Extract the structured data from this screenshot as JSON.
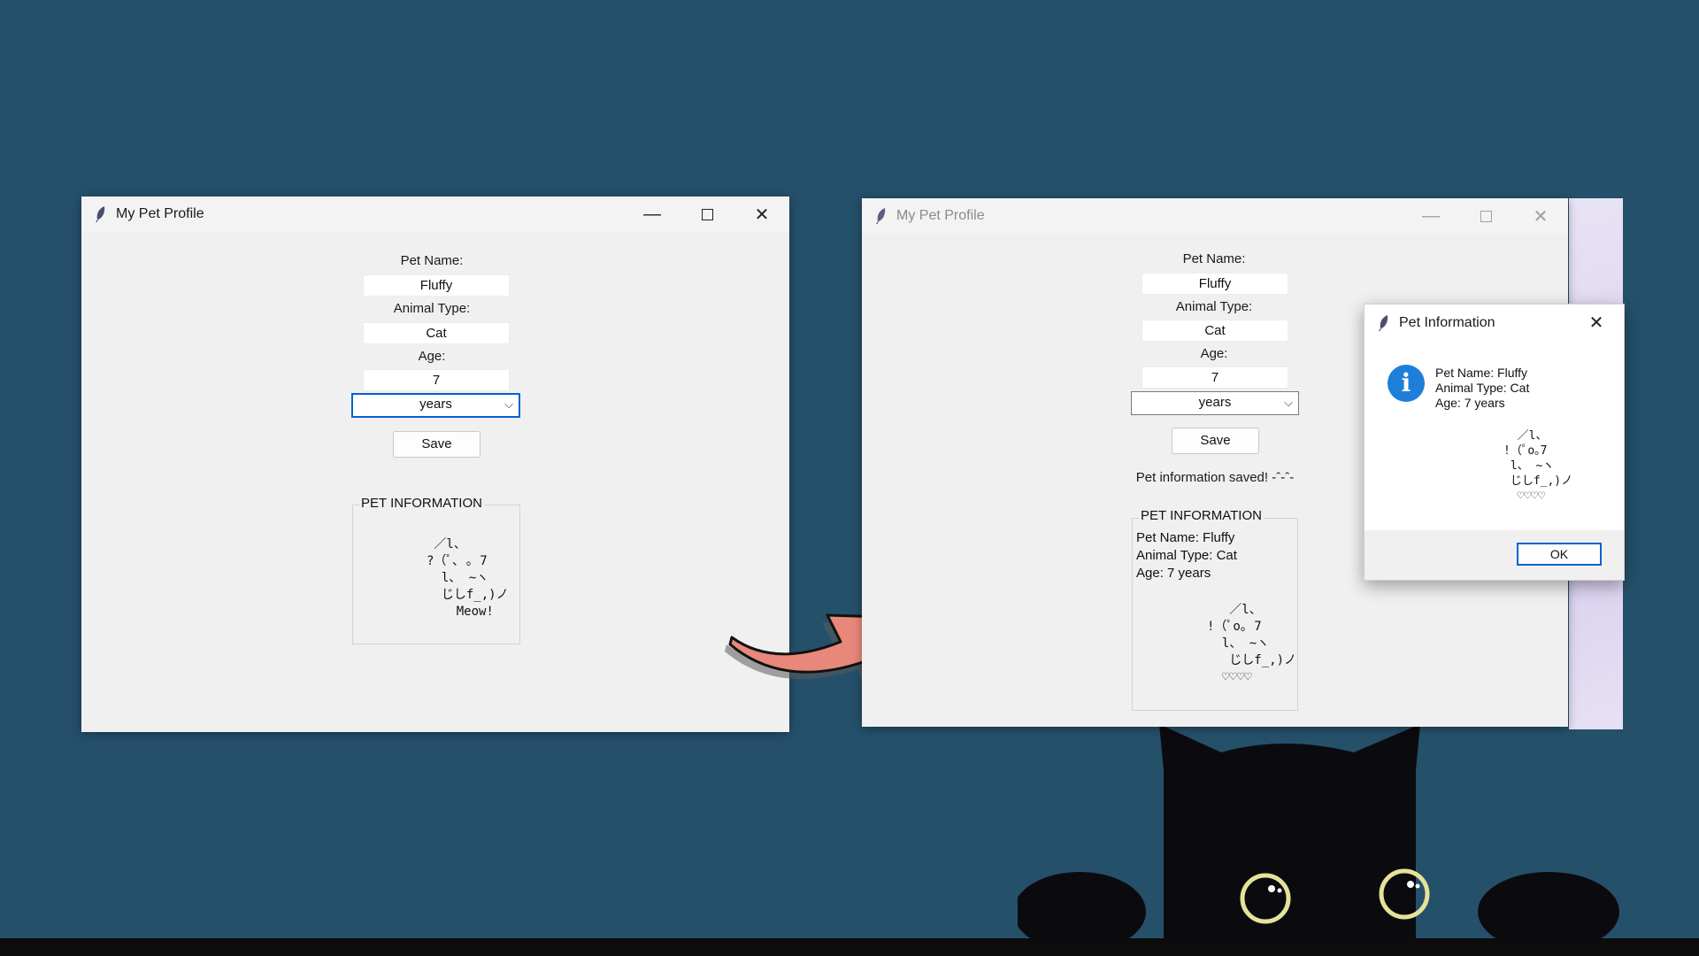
{
  "window_left": {
    "title": "My Pet Profile",
    "labels": {
      "pet_name": "Pet Name:",
      "animal_type": "Animal Type:",
      "age": "Age:"
    },
    "values": {
      "pet_name": "Fluffy",
      "animal_type": "Cat",
      "age": "7"
    },
    "age_unit": "years",
    "save_label": "Save",
    "frame_title": "PET INFORMATION",
    "ascii_art": " ／l、\n?（ﾟ､ ｡ 7\n  l、 ~ヽ\n  じしf_,)ノ\n    Meow!"
  },
  "window_right": {
    "title": "My Pet Profile",
    "labels": {
      "pet_name": "Pet Name:",
      "animal_type": "Animal Type:",
      "age": "Age:"
    },
    "values": {
      "pet_name": "Fluffy",
      "animal_type": "Cat",
      "age": "7"
    },
    "age_unit": "years",
    "save_label": "Save",
    "status": "Pet information saved! -ˆ-ˆ-",
    "frame_title": "PET INFORMATION",
    "info_lines": [
      "Pet Name: Fluffy",
      "Animal Type: Cat",
      "Age: 7 years"
    ],
    "ascii_art": "   ／l、\n!（ﾟo｡ 7\n  l、 ~ヽ\n   じしf_,)ノ\n  ♡♡♡♡"
  },
  "dialog": {
    "title": "Pet Information",
    "lines": [
      "Pet Name: Fluffy",
      "Animal Type: Cat",
      "Age: 7 years"
    ],
    "ascii_art": "  ／l、\n!（ﾟo｡7\n l、 ~ヽ\n じしf_,)ノ\n  ♡♡♡♡",
    "ok_label": "OK"
  },
  "icons": {
    "app": "feather-icon",
    "minimize": "minimize-icon",
    "maximize": "maximize-icon",
    "close": "close-icon",
    "dropdown": "chevron-down-icon",
    "info": "info-icon"
  },
  "colors": {
    "desktop": "#25506a",
    "window_bg": "#f0f0f0",
    "focus_blue": "#0063d1",
    "info_blue": "#1e7fd8",
    "arrow": "#e8887a"
  }
}
